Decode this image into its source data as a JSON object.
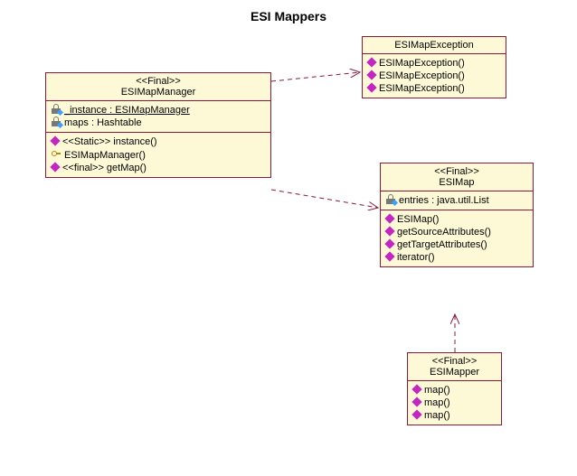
{
  "title": "ESI Mappers",
  "classes": {
    "esimapmanager": {
      "stereotype": "<<Final>>",
      "name": "ESIMapManager",
      "attributes": [
        {
          "text": "_instance : ESIMapManager",
          "underline": true,
          "icon": "lock"
        },
        {
          "text": "maps : Hashtable",
          "icon": "lock"
        }
      ],
      "operations": [
        {
          "text": "<<Static>> instance()",
          "icon": "diamond"
        },
        {
          "text": "ESIMapManager()",
          "icon": "key"
        },
        {
          "text": "<<final>> getMap()",
          "icon": "diamond"
        }
      ]
    },
    "esimapexception": {
      "name": "ESIMapException",
      "operations": [
        {
          "text": "ESIMapException()",
          "icon": "diamond"
        },
        {
          "text": "ESIMapException()",
          "icon": "diamond"
        },
        {
          "text": "ESIMapException()",
          "icon": "diamond"
        }
      ]
    },
    "esimap": {
      "stereotype": "<<Final>>",
      "name": "ESIMap",
      "attributes": [
        {
          "text": "entries : java.util.List",
          "icon": "lock"
        }
      ],
      "operations": [
        {
          "text": "ESIMap()",
          "icon": "diamond"
        },
        {
          "text": "getSourceAttributes()",
          "icon": "diamond"
        },
        {
          "text": "getTargetAttributes()",
          "icon": "diamond"
        },
        {
          "text": "iterator()",
          "icon": "diamond"
        }
      ]
    },
    "esimapper": {
      "stereotype": "<<Final>>",
      "name": "ESIMapper",
      "operations": [
        {
          "text": "map()",
          "icon": "diamond"
        },
        {
          "text": "map()",
          "icon": "diamond"
        },
        {
          "text": "map()",
          "icon": "diamond"
        }
      ]
    }
  },
  "chart_data": {
    "type": "diagram",
    "title": "ESI Mappers",
    "diagram_type": "uml-class",
    "classes": [
      {
        "name": "ESIMapManager",
        "stereotype": "Final",
        "attributes": [
          {
            "name": "_instance",
            "type": "ESIMapManager",
            "visibility": "private",
            "static": true
          },
          {
            "name": "maps",
            "type": "Hashtable",
            "visibility": "private"
          }
        ],
        "operations": [
          {
            "name": "instance",
            "stereotype": "Static"
          },
          {
            "name": "ESIMapManager",
            "visibility": "protected"
          },
          {
            "name": "getMap",
            "stereotype": "final"
          }
        ]
      },
      {
        "name": "ESIMapException",
        "operations": [
          {
            "name": "ESIMapException"
          },
          {
            "name": "ESIMapException"
          },
          {
            "name": "ESIMapException"
          }
        ]
      },
      {
        "name": "ESIMap",
        "stereotype": "Final",
        "attributes": [
          {
            "name": "entries",
            "type": "java.util.List",
            "visibility": "private"
          }
        ],
        "operations": [
          {
            "name": "ESIMap"
          },
          {
            "name": "getSourceAttributes"
          },
          {
            "name": "getTargetAttributes"
          },
          {
            "name": "iterator"
          }
        ]
      },
      {
        "name": "ESIMapper",
        "stereotype": "Final",
        "operations": [
          {
            "name": "map"
          },
          {
            "name": "map"
          },
          {
            "name": "map"
          }
        ]
      }
    ],
    "relationships": [
      {
        "from": "ESIMapManager",
        "to": "ESIMapException",
        "type": "dependency"
      },
      {
        "from": "ESIMapManager",
        "to": "ESIMap",
        "type": "dependency"
      },
      {
        "from": "ESIMapper",
        "to": "ESIMap",
        "type": "dependency"
      }
    ]
  }
}
